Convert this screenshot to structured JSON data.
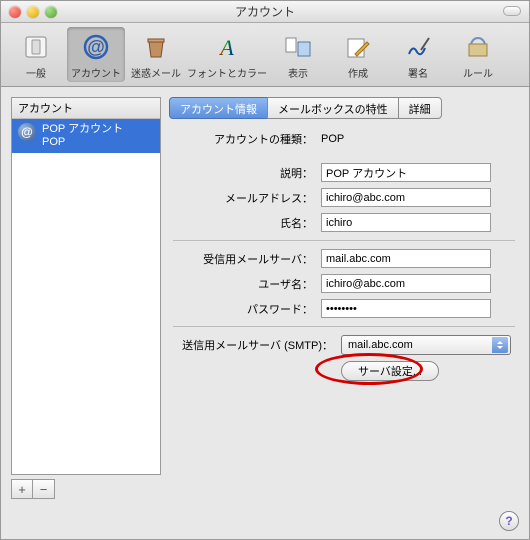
{
  "window": {
    "title": "アカウント"
  },
  "toolbar": {
    "items": [
      {
        "label": "一般"
      },
      {
        "label": "アカウント"
      },
      {
        "label": "迷惑メール"
      },
      {
        "label": "フォントとカラー"
      },
      {
        "label": "表示"
      },
      {
        "label": "作成"
      },
      {
        "label": "署名"
      },
      {
        "label": "ルール"
      }
    ]
  },
  "sidebar": {
    "header": "アカウント",
    "account": {
      "line1": "POP アカウント",
      "line2": "POP"
    },
    "add": "+",
    "remove": "−"
  },
  "tabs": {
    "info": "アカウント情報",
    "mailbox": "メールボックスの特性",
    "detail": "詳細"
  },
  "fields": {
    "type_label": "アカウントの種類：",
    "type_value": "POP",
    "desc_label": "説明：",
    "desc_value": "POP アカウント",
    "email_label": "メールアドレス：",
    "email_value": "ichiro@abc.com",
    "name_label": "氏名：",
    "name_value": "ichiro",
    "incoming_label": "受信用メールサーバ：",
    "incoming_value": "mail.abc.com",
    "user_label": "ユーザ名：",
    "user_value": "ichiro@abc.com",
    "pass_label": "パスワード：",
    "pass_value": "••••••••",
    "smtp_label": "送信用メールサーバ (SMTP)：",
    "smtp_value": "mail.abc.com",
    "server_settings_btn": "サーバ設定..."
  },
  "help": "?"
}
